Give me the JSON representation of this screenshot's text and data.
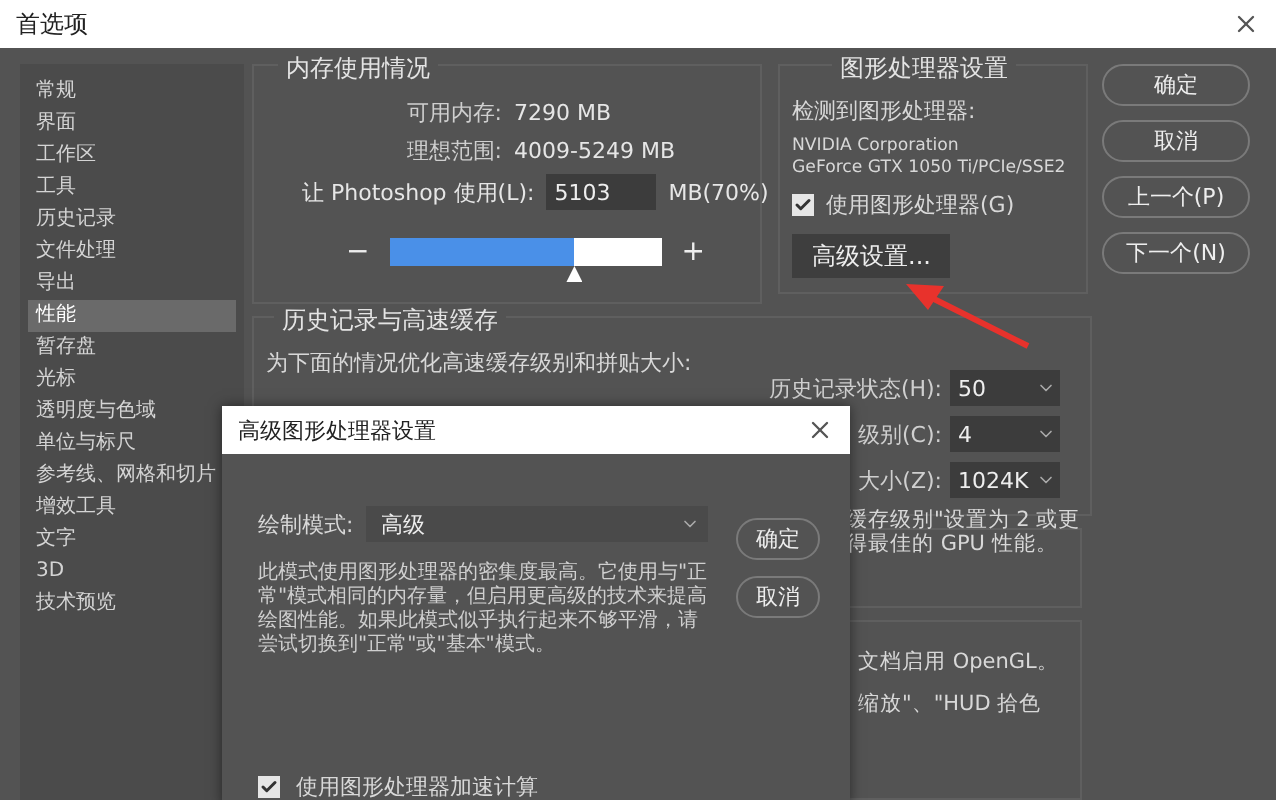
{
  "window": {
    "title": "首选项"
  },
  "sidebar": {
    "items": [
      {
        "label": "常规",
        "selected": false
      },
      {
        "label": "界面",
        "selected": false
      },
      {
        "label": "工作区",
        "selected": false
      },
      {
        "label": "工具",
        "selected": false
      },
      {
        "label": "历史记录",
        "selected": false
      },
      {
        "label": "文件处理",
        "selected": false
      },
      {
        "label": "导出",
        "selected": false
      },
      {
        "label": "性能",
        "selected": true
      },
      {
        "label": "暂存盘",
        "selected": false
      },
      {
        "label": "光标",
        "selected": false
      },
      {
        "label": "透明度与色域",
        "selected": false
      },
      {
        "label": "单位与标尺",
        "selected": false
      },
      {
        "label": "参考线、网格和切片",
        "selected": false
      },
      {
        "label": "增效工具",
        "selected": false
      },
      {
        "label": "文字",
        "selected": false
      },
      {
        "label": "3D",
        "selected": false
      },
      {
        "label": "技术预览",
        "selected": false
      }
    ]
  },
  "memory": {
    "title": "内存使用情况",
    "available_label": "可用内存:",
    "available_value": "7290 MB",
    "ideal_label": "理想范围:",
    "ideal_value": "4009-5249 MB",
    "use_label": "让 Photoshop 使用(L):",
    "use_value": "5103",
    "use_unit": "MB(70%)",
    "minus": "−",
    "plus": "+",
    "level": 0.68
  },
  "gpu": {
    "title": "图形处理器设置",
    "detected_label": "检测到图形处理器:",
    "gpu_lines": [
      "NVIDIA Corporation",
      "GeForce GTX 1050 Ti/PCIe/SSE2"
    ],
    "use_gpu": {
      "label": "使用图形处理器(G)",
      "checked": true
    },
    "advanced_button": "高级设置..."
  },
  "buttons": [
    "确定",
    "取消",
    "上一个(P)",
    "下一个(N)"
  ],
  "history": {
    "title": "历史记录与高速缓存",
    "description": "为下面的情况优化高速缓存级别和拼贴大小:",
    "fields": [
      {
        "label": "历史记录状态(H):",
        "value": "50"
      },
      {
        "label": "级别(C):",
        "value": "4"
      },
      {
        "label": "大小(Z):",
        "value": "1024K"
      }
    ],
    "notes": [
      "缓存级别\"设置为 2 或更",
      "得最佳的 GPU 性能。"
    ]
  },
  "lower_notes": [
    "文档启用 OpenGL。",
    "缩放\"、\"HUD 拾色"
  ],
  "dialog": {
    "title": "高级图形处理器设置",
    "mode_label": "绘制模式:",
    "mode_value": "高级",
    "description": "此模式使用图形处理器的密集度最高。它使用与\"正常\"模式相同的内存量，但启用更高级的技术来提高绘图性能。如果此模式似乎执行起来不够平滑，请尝试切换到\"正常\"或\"基本\"模式。",
    "buttons": [
      "确定",
      "取消"
    ],
    "compute": {
      "label": "使用图形处理器加速计算",
      "checked": true
    }
  }
}
